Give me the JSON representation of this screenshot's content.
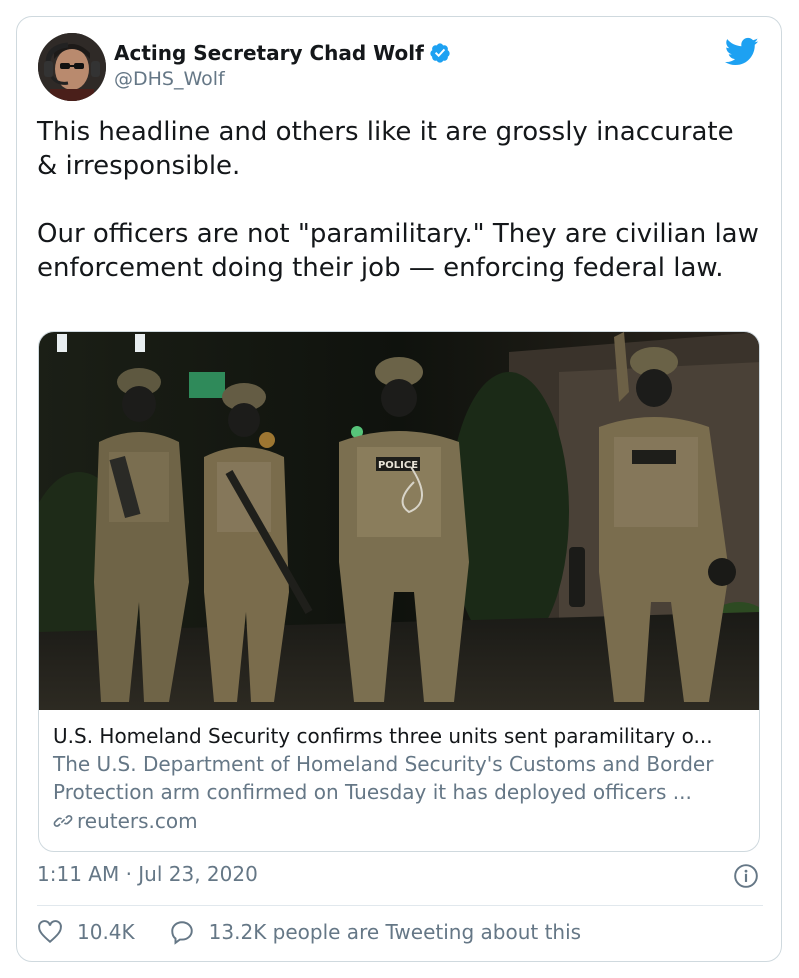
{
  "author": {
    "name": "Acting Secretary Chad Wolf",
    "handle": "@DHS_Wolf",
    "verified": true,
    "avatar_icon": "profile-photo"
  },
  "tweet": {
    "text": "This headline and others like it are grossly inaccurate & irresponsible.\n\nOur officers are not \"paramilitary.\" They are civilian law enforcement doing their job — enforcing federal law."
  },
  "link_card": {
    "image_alt": "Officers in camouflage and gas masks on a street at night",
    "title": "U.S. Homeland Security confirms three units sent paramilitary o...",
    "description_line1": "The U.S. Department of Homeland Security's Customs and Border",
    "description_line2": "Protection arm confirmed on Tuesday it has deployed officers ...",
    "domain": "reuters.com",
    "badge_text": "POLICE"
  },
  "meta": {
    "timestamp": "1:11 AM · Jul 23, 2020"
  },
  "actions": {
    "likes": "10.4K",
    "tweeting": "13.2K people are Tweeting about this"
  },
  "colors": {
    "brand_blue": "#1da1f2",
    "muted": "#657786",
    "border": "#cfd9de"
  }
}
